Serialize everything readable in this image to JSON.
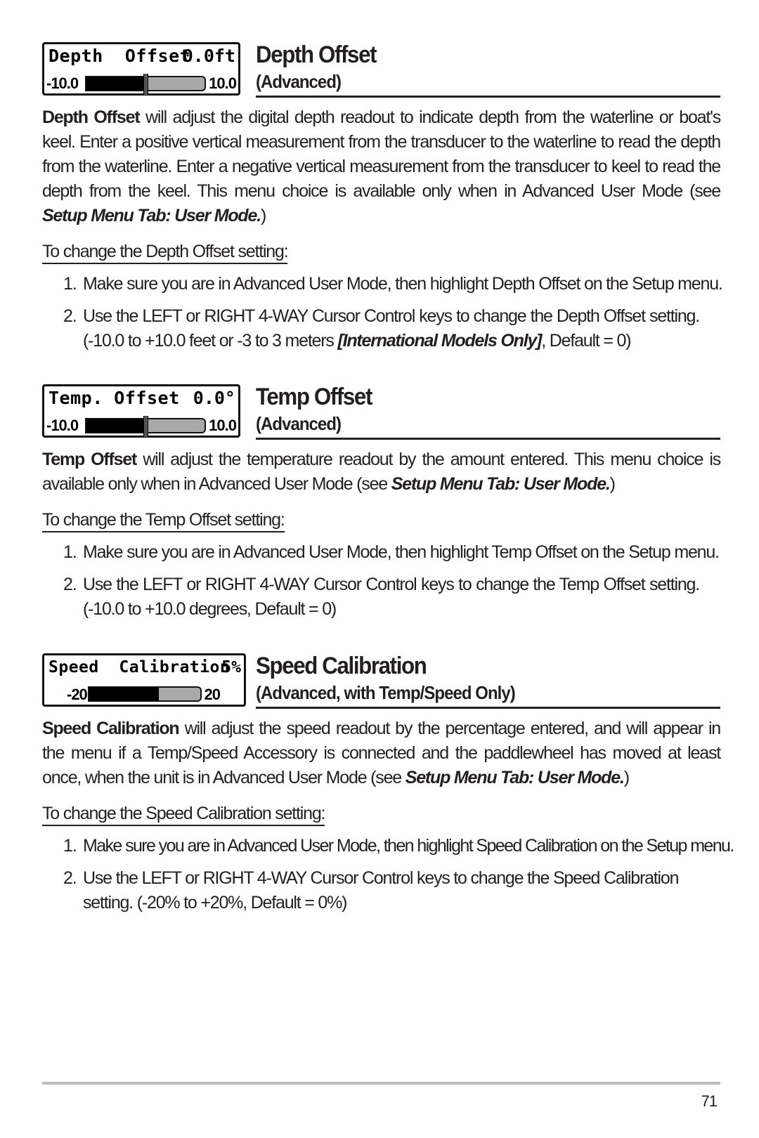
{
  "sections": [
    {
      "id": "depth-offset",
      "lcd": {
        "label": "Depth  Offset",
        "value": "0.0ft",
        "min": "-10.0",
        "max": "10.0",
        "current": 0,
        "range": [
          -10,
          10
        ]
      },
      "title": "Depth Offset",
      "subtitle": "(Advanced)",
      "description_bold": "Depth Offset",
      "description": " will adjust the digital depth readout to indicate depth from the waterline or boat's keel. Enter a positive vertical measurement from the transducer to the waterline to read the depth from the waterline. Enter a negative vertical measurement from the transducer to keel to read the depth from the keel. This menu choice is available only when in Advanced User Mode (see ",
      "description_ref": "Setup Menu Tab: User Mode.",
      "description_end": ")",
      "procedure_heading": "To change the Depth Offset setting:",
      "steps": [
        {
          "num": "1.",
          "text": "Make sure you are in Advanced User Mode, then highlight Depth Offset on the Setup menu."
        },
        {
          "num": "2.",
          "text": "Use the LEFT or RIGHT 4-WAY Cursor Control keys to change the Depth Offset setting. (-10.0 to +10.0 feet or -3 to 3 meters ",
          "ref": "[International Models Only]",
          "text_end": ", Default = 0)"
        }
      ]
    },
    {
      "id": "temp-offset",
      "lcd": {
        "label": "Temp. Offset",
        "value": "0.0°",
        "min": "-10.0",
        "max": "10.0",
        "current": 0,
        "range": [
          -10,
          10
        ]
      },
      "title": "Temp Offset",
      "subtitle": "(Advanced)",
      "description_bold": "Temp Offset",
      "description": " will adjust the temperature readout by the amount entered. This menu choice is available only when in Advanced User Mode  (see ",
      "description_ref": "Setup Menu Tab: User Mode.",
      "description_end": ")",
      "procedure_heading": "To change the Temp Offset setting:",
      "steps": [
        {
          "num": "1.",
          "text": "Make sure you are in Advanced User Mode, then highlight Temp Offset on the Setup menu."
        },
        {
          "num": "2.",
          "text": "Use the LEFT or RIGHT 4-WAY Cursor Control keys to change the Temp Offset setting. (-10.0 to +10.0 degrees, Default = 0)"
        }
      ]
    },
    {
      "id": "speed-calibration",
      "lcd": {
        "label": "Speed  Calibration",
        "value": "5%",
        "min": "-20",
        "max": "20",
        "current": 5,
        "range": [
          -20,
          20
        ]
      },
      "title": "Speed Calibration",
      "subtitle": "(Advanced, with Temp/Speed Only)",
      "description_bold": "Speed Calibration",
      "description": " will adjust the speed readout by the percentage entered, and will appear in the menu if a Temp/Speed Accessory is connected and the paddlewheel has moved at least once, when the unit is in Advanced User Mode (see ",
      "description_ref": "Setup Menu Tab: User Mode.",
      "description_end": ")",
      "procedure_heading": "To change the Speed Calibration setting:",
      "steps": [
        {
          "num": "1.",
          "text": "Make sure you are in Advanced User Mode, then highlight Speed Calibration on the Setup menu."
        },
        {
          "num": "2.",
          "text": "Use the LEFT or RIGHT 4-WAY Cursor Control keys to change the Speed Calibration setting. (-20% to +20%, Default = 0%)"
        }
      ]
    }
  ],
  "footer": {
    "page_number": "71"
  }
}
